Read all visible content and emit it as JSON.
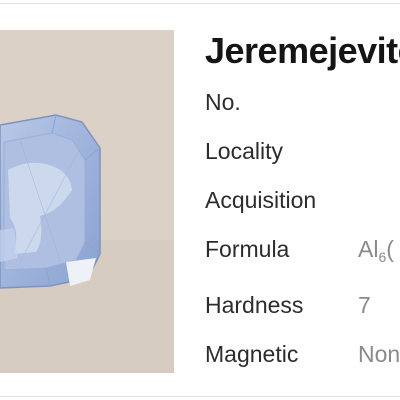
{
  "header": {
    "title": "Jeremejevite"
  },
  "image": {
    "alt": "Jeremejevite gemstone photo"
  },
  "details": [
    {
      "label": "No.",
      "value": ""
    },
    {
      "label": "Locality",
      "value": ""
    },
    {
      "label": "Acquisition",
      "value": ""
    },
    {
      "label": "Formula",
      "value": "Al6(",
      "value_main": "Al",
      "value_sub": "6",
      "value_rest": "("
    },
    {
      "label": "Hardness",
      "value": "7"
    },
    {
      "label": "Magnetic",
      "value": "Non"
    }
  ],
  "colors": {
    "title": "#151515",
    "label": "#2c2c2c",
    "value": "#8a8a8a",
    "photo_background": "#dad0c6",
    "gem": "#a9bde0"
  },
  "icons": []
}
